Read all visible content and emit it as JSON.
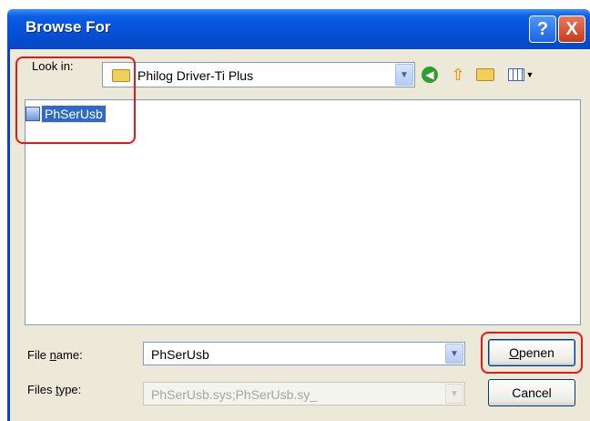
{
  "window": {
    "title": "Browse For",
    "help_label": "?",
    "close_label": "X"
  },
  "lookin": {
    "label": "Look in:",
    "value": "Philog Driver-Ti Plus"
  },
  "toolbar": {
    "icons": [
      "back-icon",
      "up-folder-icon",
      "new-folder-icon",
      "views-menu-icon"
    ]
  },
  "filelist": {
    "items": [
      {
        "label": "PhSerUsb",
        "icon": "system-file-icon",
        "selected": true
      }
    ]
  },
  "filename": {
    "label_prefix": "File ",
    "label_underline": "n",
    "label_suffix": "ame:",
    "value": "PhSerUsb"
  },
  "filetype": {
    "label_prefix": "Files ",
    "label_underline": "t",
    "label_suffix": "ype:",
    "value": "PhSerUsb.sys;PhSerUsb.sy_"
  },
  "buttons": {
    "open_underline": "O",
    "open_rest": "penen",
    "cancel": "Cancel"
  },
  "colors": {
    "titlebar": "#0551d8",
    "dialog_bg": "#ece9d8",
    "selection": "#316ac5",
    "annotation": "#e01b1b"
  }
}
